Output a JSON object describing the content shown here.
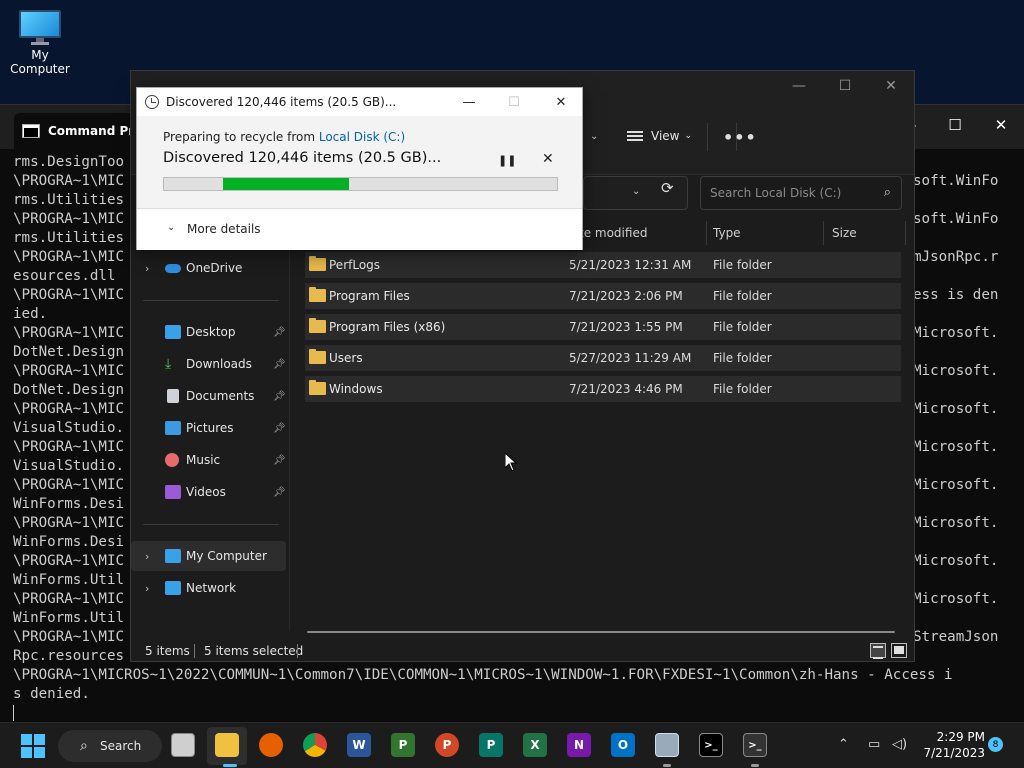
{
  "desktop": {
    "icon_label": "My Computer"
  },
  "cmd": {
    "title": "Command Pro",
    "left_lines": [
      "rms.DesignToo",
      "\\PROGRA~1\\MIC",
      "rms.Utilities",
      "\\PROGRA~1\\MIC",
      "rms.Utilities",
      "\\PROGRA~1\\MIC",
      "esources.dll",
      "\\PROGRA~1\\MIC",
      "ied.",
      "\\PROGRA~1\\MIC",
      "DotNet.Design",
      "\\PROGRA~1\\MIC",
      "DotNet.Design",
      "\\PROGRA~1\\MIC",
      "VisualStudio.",
      "\\PROGRA~1\\MIC",
      "VisualStudio.",
      "\\PROGRA~1\\MIC",
      "WinForms.Desi",
      "\\PROGRA~1\\MIC",
      "WinForms.Desi",
      "\\PROGRA~1\\MIC",
      "WinForms.Util",
      "\\PROGRA~1\\MIC",
      "WinForms.Util",
      "\\PROGRA~1\\MIC",
      "Rpc.resources"
    ],
    "right_lines": [
      "",
      "soft.WinFo",
      "",
      "soft.WinFo",
      "",
      "mJsonRpc.r",
      "",
      "ess is den",
      "",
      "Microsoft.",
      "",
      "Microsoft.",
      "",
      "Microsoft.",
      "",
      "Microsoft.",
      "",
      "Microsoft.",
      "",
      "Microsoft.",
      "",
      "Microsoft.",
      "",
      "Microsoft.",
      "",
      "StreamJson",
      ""
    ],
    "bottom_lines": [
      "\\PROGRA~1\\MICROS~1\\2022\\COMMUN~1\\Common7\\IDE\\COMMON~1\\MICROS~1\\WINDOW~1.FOR\\FXDESI~1\\Common\\zh-Hans - Access i",
      "s denied."
    ]
  },
  "explorer": {
    "toolbar": {
      "view_label": "View",
      "more_label": "•••"
    },
    "search_placeholder": "Search Local Disk (C:)",
    "columns": {
      "date": "te modified",
      "type": "Type",
      "size": "Size"
    },
    "nav": [
      {
        "label": "OneDrive",
        "icon": "cloud-icon"
      },
      {
        "label": "Desktop",
        "icon": "desktop-icon"
      },
      {
        "label": "Downloads",
        "icon": "download-icon"
      },
      {
        "label": "Documents",
        "icon": "document-icon"
      },
      {
        "label": "Pictures",
        "icon": "pictures-icon"
      },
      {
        "label": "Music",
        "icon": "music-icon"
      },
      {
        "label": "Videos",
        "icon": "videos-icon"
      },
      {
        "label": "My Computer",
        "icon": "computer-icon"
      },
      {
        "label": "Network",
        "icon": "network-icon"
      }
    ],
    "rows": [
      {
        "name": "PerfLogs",
        "date": "5/21/2023 12:31 AM",
        "type": "File folder"
      },
      {
        "name": "Program Files",
        "date": "7/21/2023 2:06 PM",
        "type": "File folder"
      },
      {
        "name": "Program Files (x86)",
        "date": "7/21/2023 1:55 PM",
        "type": "File folder"
      },
      {
        "name": "Users",
        "date": "5/27/2023 11:29 AM",
        "type": "File folder"
      },
      {
        "name": "Windows",
        "date": "7/21/2023 4:46 PM",
        "type": "File folder"
      }
    ],
    "status": {
      "count": "5 items",
      "selected": "5 items selected"
    }
  },
  "dialog": {
    "title": "Discovered 120,446 items (20.5 GB)...",
    "prep_text": "Preparing to recycle from ",
    "prep_link": "Local Disk (C:)",
    "headline": "Discovered 120,446 items (20.5 GB)...",
    "progress_start": 0.15,
    "progress_end": 0.47,
    "more_details": "More details",
    "progress_color": "#06b025"
  },
  "taskbar": {
    "search_label": "Search",
    "time": "2:29 PM",
    "date": "7/21/2023",
    "notifications": "8",
    "accent": "#4cc2ff"
  }
}
